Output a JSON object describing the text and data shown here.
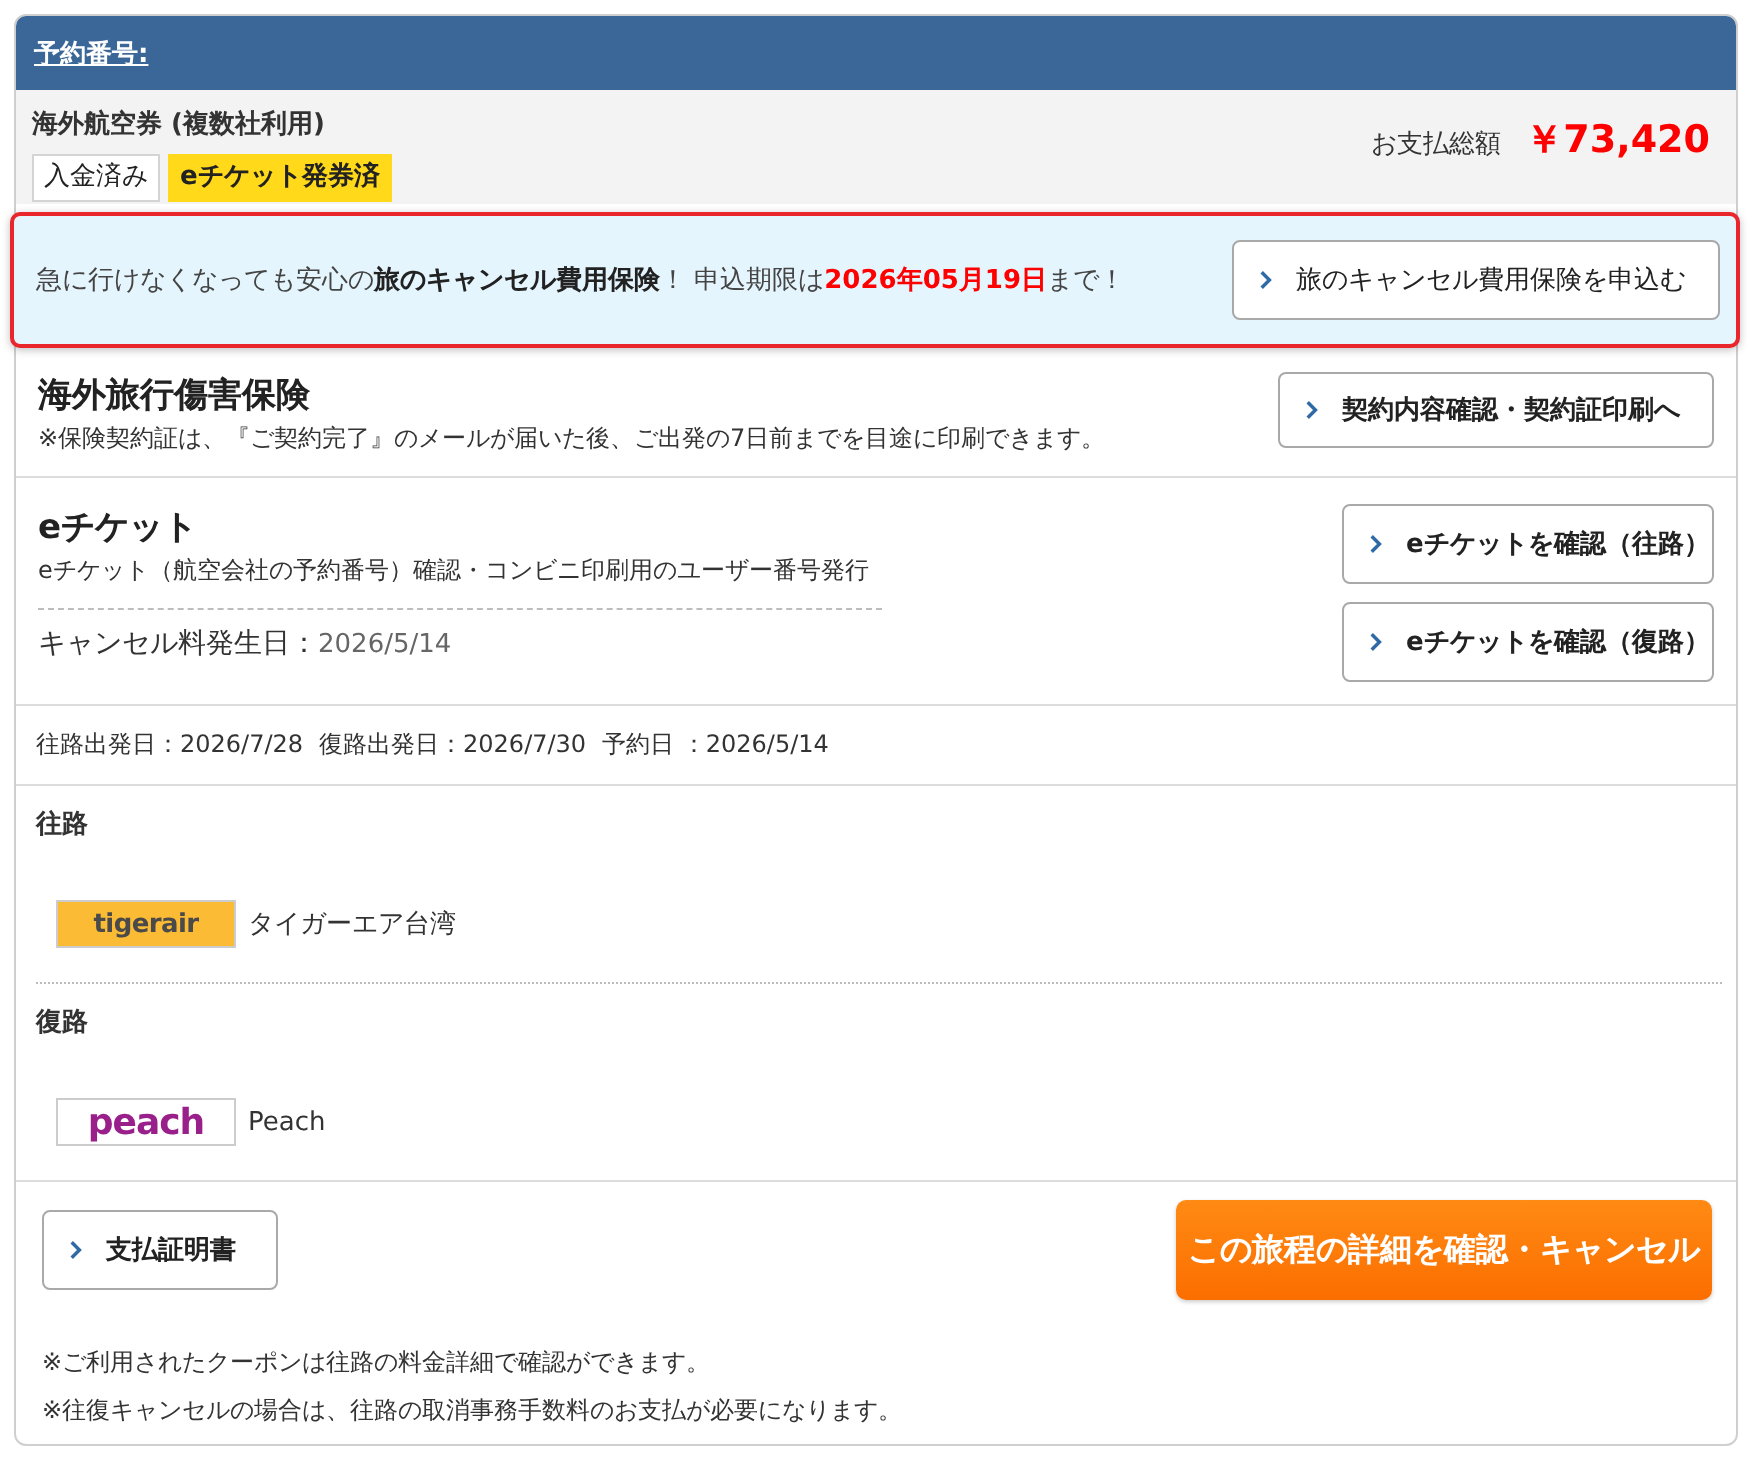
{
  "header": {
    "title": "予約番号:"
  },
  "summary": {
    "product": "海外航空券 (複数社利用)",
    "badges": [
      {
        "label": "入金済み",
        "color": "#ffffff"
      },
      {
        "label": "eチケット発券済",
        "color": "#ffd91a"
      }
    ],
    "total_label": "お支払総額",
    "total": "￥73,420"
  },
  "promo": {
    "message": [
      {
        "kind": "plain",
        "text": "急に行けなくなっても安心の"
      },
      {
        "kind": "bold",
        "text": "旅のキャンセル費用保険"
      },
      {
        "kind": "plain",
        "text": "！ 申込期限は"
      },
      {
        "kind": "deadline",
        "text": "2026年05月19日"
      },
      {
        "kind": "plain",
        "text": "まで！"
      }
    ],
    "button": "旅のキャンセル費用保険を申込む"
  },
  "insurance": {
    "title": "海外旅行傷害保険",
    "note": "※保険契約証は、『ご契約完了』のメールが届いた後、ご出発の7日前までを目途に印刷できます。",
    "button": "契約内容確認・契約証印刷へ"
  },
  "eticket": {
    "title": "eチケット",
    "description": "eチケット（航空会社の予約番号）確認・コンビニ印刷用のユーザー番号発行",
    "cancel_fee_label": "キャンセル料発生日：",
    "cancel_fee_date": "2026/5/14",
    "buttons": [
      "eチケットを確認（往路）",
      "eチケットを確認（復路）"
    ]
  },
  "dates": [
    "往路出発日：2026/7/28",
    "復路出発日：2026/7/30",
    "予約日 ：2026/5/14"
  ],
  "legs": [
    {
      "label": "往路",
      "kind": "tiger",
      "logo_text": "tigerair",
      "airline": "タイガーエア台湾"
    },
    {
      "label": "復路",
      "kind": "peach",
      "logo_text": "peach",
      "airline": "Peach"
    }
  ],
  "footer": {
    "button": "支払証明書",
    "primary_button": "この旅程の詳細を確認・キャンセル",
    "notes": [
      "※ご利用されたクーポンは往路の料金詳細で確認ができます。",
      "※往復キャンセルの場合は、往路の取消事務手数料のお支払が必要になります。"
    ]
  }
}
